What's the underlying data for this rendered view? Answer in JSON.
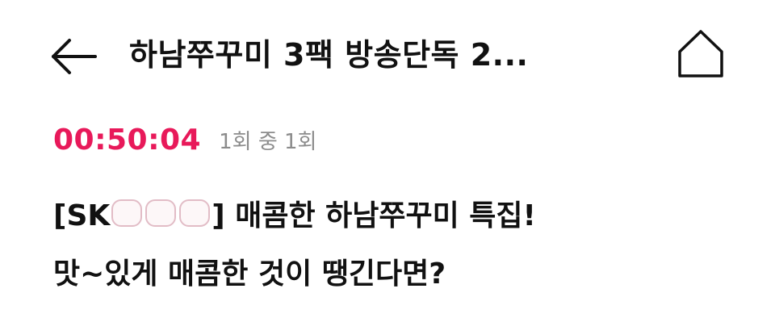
{
  "header": {
    "back_icon": "arrow-left-icon",
    "title": "하남쭈꾸미 3팩 방송단독 2...",
    "home_icon": "home-icon"
  },
  "broadcast": {
    "timer": "00:50:04",
    "episode": "1회 중 1회",
    "timer_color": "#e8195a"
  },
  "description": {
    "line1_prefix": "[SK",
    "line1_redacted_count": 3,
    "line1_suffix": "] 매콤한 하남쭈꾸미 특집!",
    "line2": "맛~있게 매콤한 것이 땡긴다면?"
  }
}
